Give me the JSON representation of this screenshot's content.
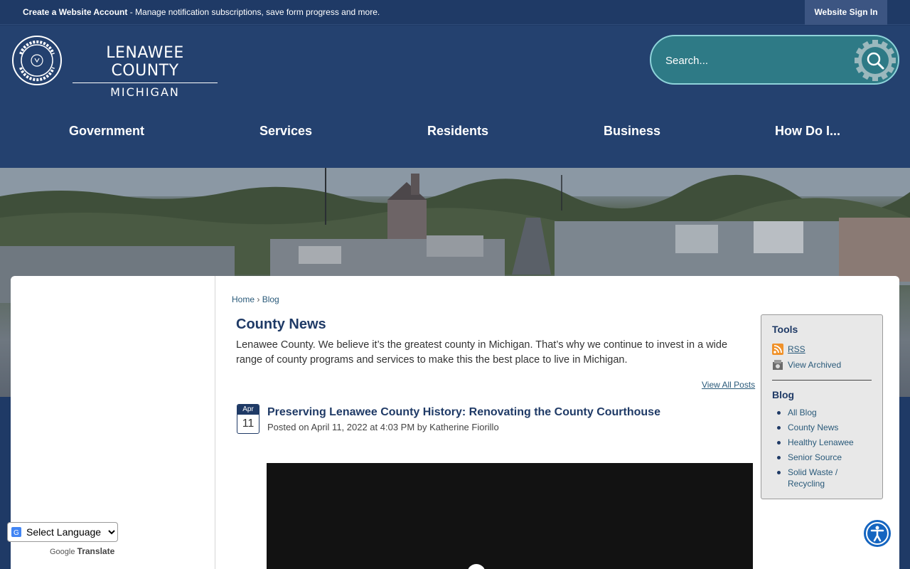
{
  "topbar": {
    "create_account": "Create a Website Account",
    "create_account_desc": " - Manage notification subscriptions, save form progress and more.",
    "sign_in": "Website Sign In"
  },
  "logo": {
    "line1": "LENAWEE COUNTY",
    "line2": "MICHIGAN"
  },
  "search": {
    "placeholder": "Search..."
  },
  "nav": {
    "items": [
      {
        "label": "Government"
      },
      {
        "label": "Services"
      },
      {
        "label": "Residents"
      },
      {
        "label": "Business"
      },
      {
        "label": "How Do I..."
      }
    ]
  },
  "breadcrumb": {
    "home": "Home",
    "separator": "›",
    "current": "Blog"
  },
  "page": {
    "title": "County News",
    "description": "Lenawee County. We believe it’s the greatest county in Michigan. That’s why we continue to invest in a wide range of county programs and services to make this the best place to live in Michigan.",
    "view_all": "View All Posts"
  },
  "post": {
    "month": "Apr",
    "day": "11",
    "title": "Preserving Lenawee County History: Renovating the County Courthouse",
    "meta": "Posted on April 11, 2022 at 4:03 PM by Katherine Fiorillo"
  },
  "tools": {
    "heading": "Tools",
    "rss": "RSS",
    "archived": "View Archived",
    "blog_heading": "Blog",
    "blog_links": [
      "All Blog",
      "County News",
      "Healthy Lenawee",
      "Senior Source",
      "Solid Waste / Recycling"
    ]
  },
  "translate": {
    "select_label": "Select Language",
    "powered_prefix": "Google",
    "powered_suffix": "Translate"
  },
  "colors": {
    "navy": "#1f3a66",
    "search_teal": "#2e7a86",
    "link": "#2a5a7a",
    "accessibility_blue": "#1565c0"
  }
}
